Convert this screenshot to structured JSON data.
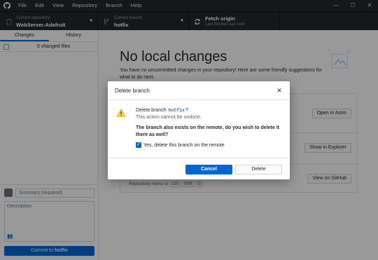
{
  "menu": [
    "File",
    "Edit",
    "View",
    "Repository",
    "Branch",
    "Help"
  ],
  "window_controls": [
    "—",
    "☐",
    "✕"
  ],
  "toolbar": {
    "repo_label": "Current repository",
    "repo_name": "WebServer-Adafruit",
    "branch_label": "Current branch",
    "branch_name": "hotfix",
    "fetch_title": "Fetch origin",
    "fetch_sub": "Last fetched just now"
  },
  "sidebar": {
    "tabs": [
      "Changes",
      "History"
    ],
    "changed_files": "0 changed files",
    "summary_placeholder": "Summary (required)",
    "description_placeholder": "Description",
    "commit_prefix": "Commit to ",
    "commit_branch": "hotfix"
  },
  "main": {
    "title": "No local changes",
    "subtitle": "You have no uncommitted changes in your repository! Here are some friendly suggestions for what to do next.",
    "buttons": [
      "Open in Atom",
      "Show in Explorer",
      "View on GitHub"
    ],
    "menu_note_prefix": "Repository menu or",
    "keys": [
      "Ctrl",
      "Shift",
      "G"
    ]
  },
  "dialog": {
    "title": "Delete branch",
    "close": "✕",
    "line1_prefix": "Delete branch ",
    "branch": "hotfix",
    "line1_suffix": "?",
    "line2": "This action cannot be undone.",
    "remote_question": "The branch also exists on the remote, do you wish to delete it there as well?",
    "checkbox_label": "Yes, delete this branch on the remote",
    "cancel": "Cancel",
    "delete": "Delete"
  },
  "colors": {
    "accent": "#0366d6",
    "titlebar": "#24292e",
    "warning": "#ffd33d"
  }
}
